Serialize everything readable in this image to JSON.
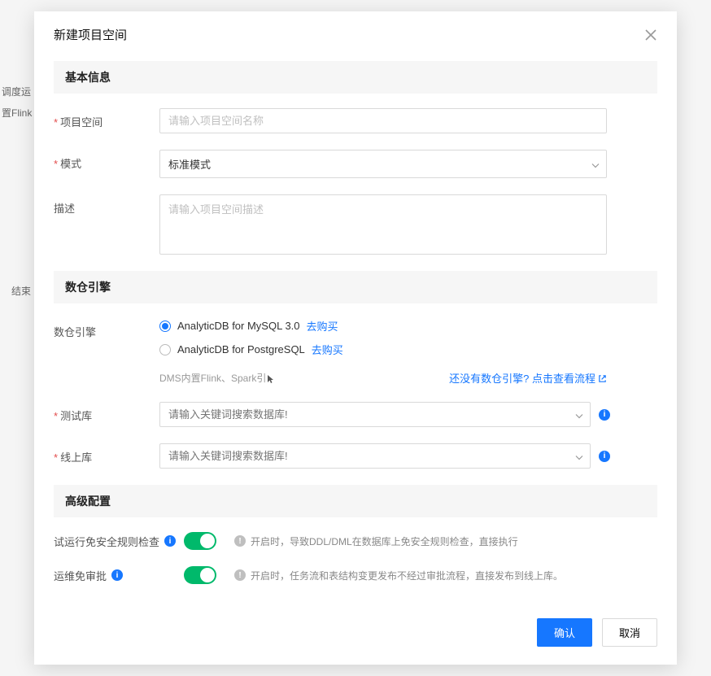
{
  "backdrop": {
    "line1": "调度运",
    "line2": "置Flink",
    "line3": "结束"
  },
  "modal": {
    "title": "新建项目空间"
  },
  "sections": {
    "basic": "基本信息",
    "engine": "数仓引擎",
    "advanced": "高级配置"
  },
  "basic": {
    "projectSpace": {
      "label": "项目空间",
      "placeholder": "请输入项目空间名称"
    },
    "mode": {
      "label": "模式",
      "value": "标准模式"
    },
    "description": {
      "label": "描述",
      "placeholder": "请输入项目空间描述"
    }
  },
  "engine": {
    "label": "数仓引擎",
    "option1": "AnalyticDB for MySQL 3.0",
    "option2": "AnalyticDB for PostgreSQL",
    "buyLink": "去购买",
    "note": "DMS内置Flink、Spark引",
    "noEngineHint": "还没有数仓引擎? 点击查看流程",
    "testDb": {
      "label": "测试库",
      "placeholder": "请输入关键词搜索数据库!"
    },
    "prodDb": {
      "label": "线上库",
      "placeholder": "请输入关键词搜索数据库!"
    }
  },
  "advanced": {
    "skipSecurity": {
      "label": "试运行免安全规则检查",
      "desc": "开启时，导致DDL/DML在数据库上免安全规则检查，直接执行"
    },
    "skipApproval": {
      "label": "运维免审批",
      "desc": "开启时，任务流和表结构变更发布不经过审批流程，直接发布到线上库。"
    }
  },
  "footer": {
    "confirm": "确认",
    "cancel": "取消"
  }
}
